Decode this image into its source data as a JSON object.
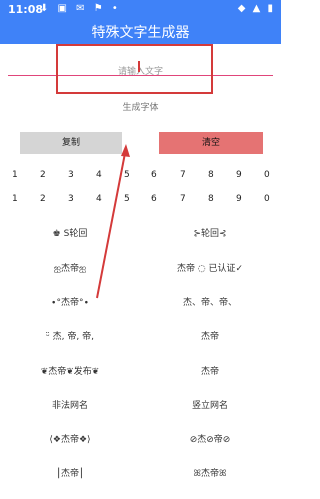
{
  "status": {
    "time": "11:08",
    "left_icons": "⬇ ▣ ✉ ⚑ •",
    "right_icons": "◆ ▲ ▮"
  },
  "app": {
    "title": "特殊文字生成器"
  },
  "input": {
    "placeholder": "请输入文字"
  },
  "result": {
    "text": "生成字体"
  },
  "buttons": {
    "copy": "复制",
    "clear": "清空"
  },
  "numbers_row": [
    "1",
    "2",
    "3",
    "4",
    "5",
    "6",
    "7",
    "8",
    "9",
    "0"
  ],
  "styles": [
    {
      "left": "♚ S轮回",
      "right": "⊱轮回⊰"
    },
    {
      "left": "ஐ杰帝ஐ",
      "right": "杰帝 ◌ 已认证✓"
    },
    {
      "left": "∙°杰帝°∙",
      "right": "杰、帝、帝、"
    },
    {
      "left": "ᵕ̈ 杰, 帝, 帝,",
      "right": "杰帝"
    },
    {
      "left": "❦杰帝❦发布❦",
      "right": "杰帝"
    },
    {
      "left": "非法网名",
      "right": "竖立网名"
    },
    {
      "left": "⟨❖杰帝❖⟩",
      "right": "⊘杰⊘帝⊘"
    },
    {
      "left": "⎮杰帝⎮",
      "right": "ꕤ杰帝ꕤ"
    }
  ]
}
